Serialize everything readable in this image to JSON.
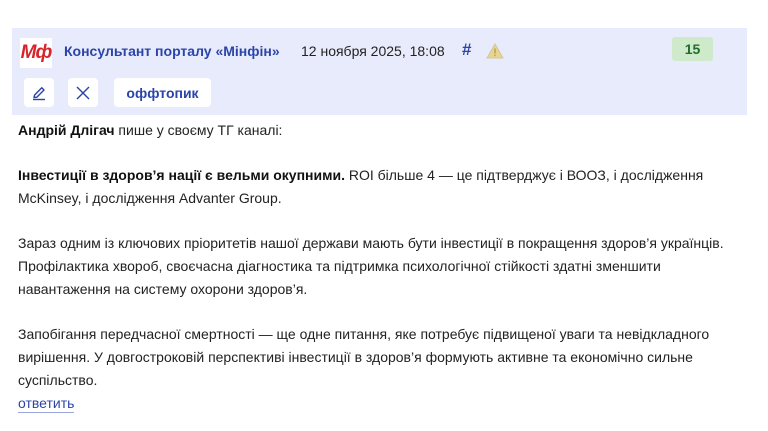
{
  "header": {
    "logo_text": "Мф",
    "author": "Консультант порталу «Мінфін»",
    "date": "12 ноября 2025, 18:08",
    "anchor": "#",
    "rating": "15"
  },
  "toolbar": {
    "offtopic_label": "оффтопик"
  },
  "body": {
    "p1_bold": "Андрій Длігач",
    "p1_rest": " пише у своєму ТГ каналі:",
    "p2_bold": "Інвестиції в здоров’я нації є вельми окупними.",
    "p2_rest": " ROI більше 4 — це підтверджує і ВООЗ, і дослідження McKinsey, і дослідження Advanter Group.",
    "p3": "Зараз одним із ключових пріоритетів нашої держави мають бути інвестиції в покращення здоров’я українців. Профілактика хвороб, своєчасна діагностика та підтримка психологічної стійкості здатні зменшити навантаження на систему охорони здоров’я.",
    "p4": "Запобігання передчасної смертності — ще одне питання, яке потребує підвищеної уваги та невідкладного вирішення. У довгостроковій перспективі інвестиції в здоров’я формують активне та економічно сильне суспільство."
  },
  "footer": {
    "reply_label": "ответить"
  },
  "colors": {
    "header_bg": "#e8ebfb",
    "link": "#2b44a8",
    "logo_red": "#d9232a",
    "rating_bg": "#cfeacb"
  }
}
